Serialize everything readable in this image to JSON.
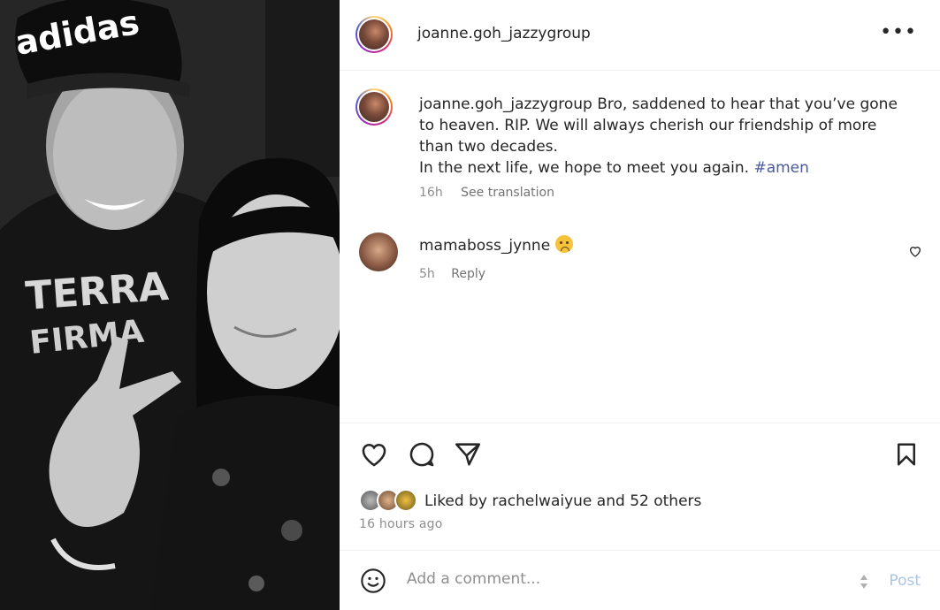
{
  "photo": {
    "cap_text": "adidas",
    "shirt_text_line1": "TERRA",
    "shirt_text_line2": "FIRMA"
  },
  "header": {
    "username": "joanne.goh_jazzygroup",
    "more_label": "•••"
  },
  "caption": {
    "username": "joanne.goh_jazzygroup",
    "text": " Bro, saddened to hear that you’ve gone to heaven. RIP. We will always cherish our friendship of more than two decades.",
    "text_line2": "In the next life, we hope to meet you again. ",
    "hashtag": "#amen",
    "time": "16h",
    "see_translation": "See translation"
  },
  "comments": [
    {
      "username": "mamaboss_jynne",
      "emoji": "sad-face-emoji",
      "time": "5h",
      "reply_label": "Reply"
    }
  ],
  "actions": {
    "liked_prefix": "Liked by ",
    "liked_user": "rachelwaiyue",
    "liked_suffix": " and 52 others",
    "time_ago": "16 hours ago"
  },
  "add_comment": {
    "placeholder": "Add a comment...",
    "post_label": "Post"
  },
  "colors": {
    "hashtag": "#4b5a99",
    "post_disabled": "#a9c4e8",
    "muted": "#8e8e8e"
  }
}
